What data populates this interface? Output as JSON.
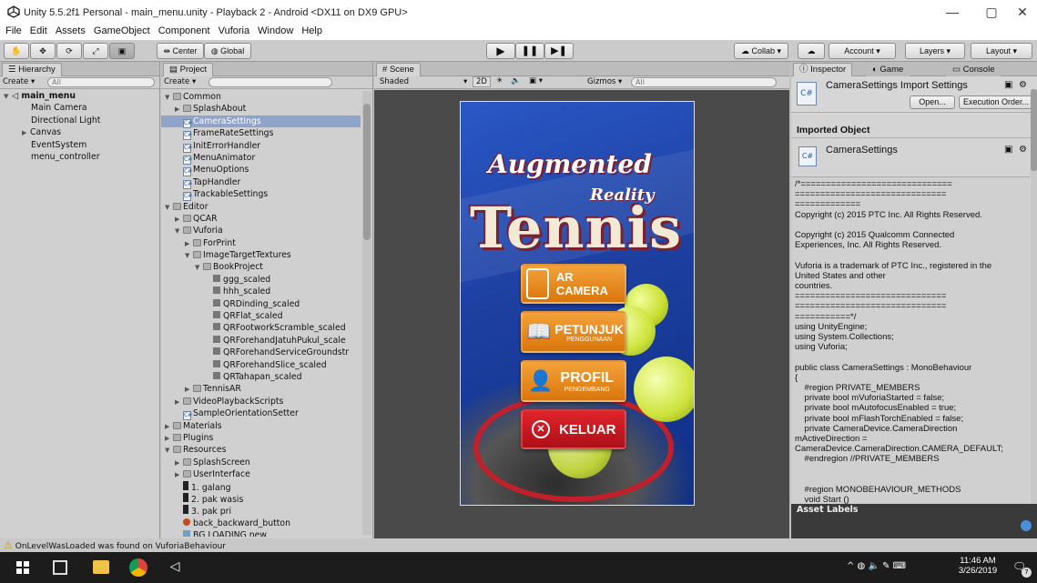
{
  "window": {
    "title": "Unity 5.5.2f1 Personal - main_menu.unity - Playback 2 - Android <DX11 on DX9 GPU>"
  },
  "menu": [
    "File",
    "Edit",
    "Assets",
    "GameObject",
    "Component",
    "Vuforia",
    "Window",
    "Help"
  ],
  "toolbar": {
    "pivot": "Center",
    "space": "Global",
    "collab": "Collab",
    "account": "Account",
    "layers": "Layers",
    "layout": "Layout"
  },
  "hierarchy": {
    "tab": "Hierarchy",
    "create": "Create",
    "search_placeholder": "All",
    "scene": "main_menu",
    "items": [
      "Main Camera",
      "Directional Light",
      "Canvas",
      "EventSystem",
      "menu_controller"
    ]
  },
  "project": {
    "tab": "Project",
    "create": "Create",
    "rows": [
      {
        "label": "Common",
        "depth": 0,
        "type": "folder",
        "open": true
      },
      {
        "label": "SplashAbout",
        "depth": 1,
        "type": "folder",
        "open": false
      },
      {
        "label": "CameraSettings",
        "depth": 1,
        "type": "script",
        "selected": true
      },
      {
        "label": "FrameRateSettings",
        "depth": 1,
        "type": "script"
      },
      {
        "label": "InitErrorHandler",
        "depth": 1,
        "type": "script"
      },
      {
        "label": "MenuAnimator",
        "depth": 1,
        "type": "script"
      },
      {
        "label": "MenuOptions",
        "depth": 1,
        "type": "script"
      },
      {
        "label": "TapHandler",
        "depth": 1,
        "type": "script"
      },
      {
        "label": "TrackableSettings",
        "depth": 1,
        "type": "script"
      },
      {
        "label": "Editor",
        "depth": 0,
        "type": "folder",
        "open": true
      },
      {
        "label": "QCAR",
        "depth": 1,
        "type": "folder",
        "open": false
      },
      {
        "label": "Vuforia",
        "depth": 1,
        "type": "folder",
        "open": true
      },
      {
        "label": "ForPrint",
        "depth": 2,
        "type": "folder",
        "open": false
      },
      {
        "label": "ImageTargetTextures",
        "depth": 2,
        "type": "folder",
        "open": true
      },
      {
        "label": "BookProject",
        "depth": 3,
        "type": "folder",
        "open": true
      },
      {
        "label": "ggg_scaled",
        "depth": 4,
        "type": "texture"
      },
      {
        "label": "hhh_scaled",
        "depth": 4,
        "type": "texture"
      },
      {
        "label": "QRDinding_scaled",
        "depth": 4,
        "type": "texture"
      },
      {
        "label": "QRFlat_scaled",
        "depth": 4,
        "type": "texture"
      },
      {
        "label": "QRFootworkScramble_scaled",
        "depth": 4,
        "type": "texture"
      },
      {
        "label": "QRForehandJatuhPukul_scale",
        "depth": 4,
        "type": "texture"
      },
      {
        "label": "QRForehandServiceGroundstr",
        "depth": 4,
        "type": "texture"
      },
      {
        "label": "QRForehandSlice_scaled",
        "depth": 4,
        "type": "texture"
      },
      {
        "label": "QRTahapan_scaled",
        "depth": 4,
        "type": "texture"
      },
      {
        "label": "TennisAR",
        "depth": 2,
        "type": "folder",
        "open": false
      },
      {
        "label": "VideoPlaybackScripts",
        "depth": 1,
        "type": "folder",
        "open": false
      },
      {
        "label": "SampleOrientationSetter",
        "depth": 1,
        "type": "script"
      },
      {
        "label": "Materials",
        "depth": 0,
        "type": "folder",
        "open": false
      },
      {
        "label": "Plugins",
        "depth": 0,
        "type": "folder",
        "open": false
      },
      {
        "label": "Resources",
        "depth": 0,
        "type": "folder",
        "open": true
      },
      {
        "label": "SplashScreen",
        "depth": 1,
        "type": "folder",
        "open": false
      },
      {
        "label": "UserInterface",
        "depth": 1,
        "type": "folder",
        "open": false
      },
      {
        "label": "1. galang",
        "depth": 1,
        "type": "media"
      },
      {
        "label": "2. pak wasis",
        "depth": 1,
        "type": "media"
      },
      {
        "label": "3. pak pri",
        "depth": 1,
        "type": "media"
      },
      {
        "label": "back_backward_button",
        "depth": 1,
        "type": "prefab"
      },
      {
        "label": "BG LOADING new",
        "depth": 1,
        "type": "image"
      }
    ]
  },
  "scene": {
    "tab": "Scene",
    "shading": "Shaded",
    "mode2d": "2D",
    "gizmos": "Gizmos",
    "search_placeholder": "All"
  },
  "game_ui": {
    "title_line1": "Augmented",
    "title_line2": "Reality",
    "title_main": "Tennis",
    "buttons": [
      {
        "label": "AR CAMERA",
        "sub": "",
        "color": "#e8870f"
      },
      {
        "label": "PETUNJUK",
        "sub": "PENGGUNAAN",
        "color": "#e8870f"
      },
      {
        "label": "PROFIL",
        "sub": "PENGEMBANG",
        "color": "#e8870f"
      },
      {
        "label": "KELUAR",
        "sub": "",
        "color": "#c4161c"
      }
    ]
  },
  "inspector": {
    "tabs": [
      "Inspector",
      "Game",
      "Console"
    ],
    "header_title": "CameraSettings Import Settings",
    "open_btn": "Open...",
    "exec_btn": "Execution Order...",
    "imported_label": "Imported Object",
    "object_name": "CameraSettings",
    "code": "/*==============================\n==============================\n=============\nCopyright (c) 2015 PTC Inc. All Rights Reserved.\n\nCopyright (c) 2015 Qualcomm Connected\nExperiences, Inc. All Rights Reserved.\n\nVuforia is a trademark of PTC Inc., registered in the\nUnited States and other\ncountries.\n==============================\n==============================\n===========*/\nusing UnityEngine;\nusing System.Collections;\nusing Vuforia;\n\npublic class CameraSettings : MonoBehaviour\n{\n    #region PRIVATE_MEMBERS\n    private bool mVuforiaStarted = false;\n    private bool mAutofocusEnabled = true;\n    private bool mFlashTorchEnabled = false;\n    private CameraDevice.CameraDirection\nmActiveDirection =\nCameraDevice.CameraDirection.CAMERA_DEFAULT;\n    #endregion //PRIVATE_MEMBERS\n\n\n    #region MONOBEHAVIOUR_METHODS\n    void Start ()\n    {\n        var vuforia = VuforiaARController.Instance;",
    "asset_labels": "Asset Labels"
  },
  "status": {
    "message": "OnLevelWasLoaded was found on VuforiaBehaviour"
  },
  "taskbar": {
    "time": "11:46 AM",
    "date": "3/26/2019",
    "notif_count": "7"
  }
}
